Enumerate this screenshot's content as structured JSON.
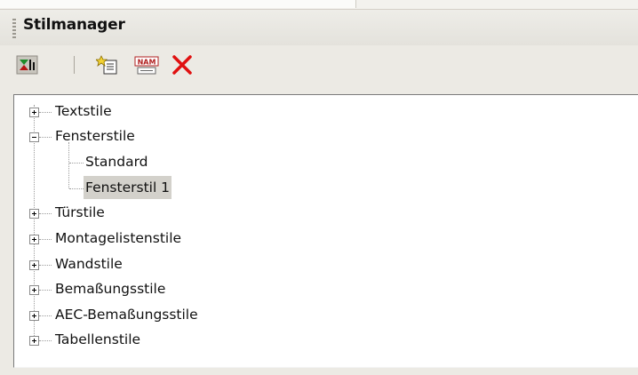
{
  "panel": {
    "title": "Stilmanager"
  },
  "toolbar": {
    "buttons": [
      {
        "name": "style-filter-button",
        "icon": "filter-icon"
      },
      {
        "name": "new-style-button",
        "icon": "new-style-icon"
      },
      {
        "name": "rename-style-button",
        "icon": "name-icon",
        "text": "NAM"
      },
      {
        "name": "delete-style-button",
        "icon": "delete-x-icon"
      }
    ]
  },
  "tree": {
    "items": [
      {
        "label": "Textstile",
        "expanded": false
      },
      {
        "label": "Fensterstile",
        "expanded": true,
        "children": [
          {
            "label": "Standard"
          },
          {
            "label": "Fensterstil 1",
            "selected": true
          }
        ]
      },
      {
        "label": "Türstile",
        "expanded": false
      },
      {
        "label": "Montagelistenstile",
        "expanded": false
      },
      {
        "label": "Wandstile",
        "expanded": false
      },
      {
        "label": "Bemaßungsstile",
        "expanded": false
      },
      {
        "label": "AEC-Bemaßungsstile",
        "expanded": false
      },
      {
        "label": "Tabellenstile",
        "expanded": false
      }
    ]
  },
  "colors": {
    "delete": "#e01010",
    "selection": "#d3d1cb",
    "panel": "#eceae4"
  }
}
